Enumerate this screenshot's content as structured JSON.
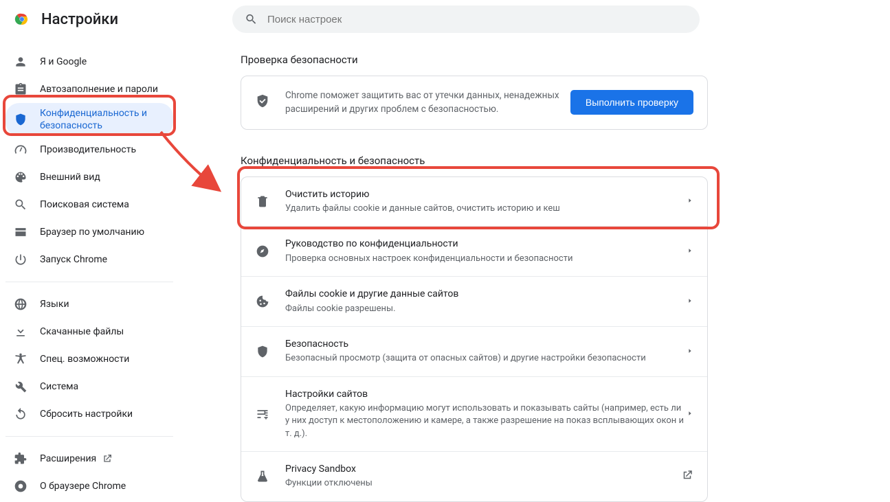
{
  "header": {
    "title": "Настройки",
    "search_placeholder": "Поиск настроек"
  },
  "sidebar": {
    "items": [
      {
        "label": "Я и Google",
        "icon": "person"
      },
      {
        "label": "Автозаполнение и пароли",
        "icon": "assignment"
      },
      {
        "label": "Конфиденциальность и безопасность",
        "icon": "shield",
        "selected": true
      },
      {
        "label": "Производительность",
        "icon": "speed"
      },
      {
        "label": "Внешний вид",
        "icon": "palette"
      },
      {
        "label": "Поисковая система",
        "icon": "search"
      },
      {
        "label": "Браузер по умолчанию",
        "icon": "browser"
      },
      {
        "label": "Запуск Chrome",
        "icon": "power"
      }
    ],
    "items2": [
      {
        "label": "Языки",
        "icon": "globe"
      },
      {
        "label": "Скачанные файлы",
        "icon": "download"
      },
      {
        "label": "Спец. возможности",
        "icon": "accessibility"
      },
      {
        "label": "Система",
        "icon": "wrench"
      },
      {
        "label": "Сбросить настройки",
        "icon": "reset"
      }
    ],
    "items3": [
      {
        "label": "Расширения",
        "icon": "extension",
        "external": true
      },
      {
        "label": "О браузере Chrome",
        "icon": "chrome"
      }
    ]
  },
  "safety": {
    "section_label": "Проверка безопасности",
    "text": "Chrome поможет защитить вас от утечки данных, ненадежных расширений и других проблем с безопасностью.",
    "button_label": "Выполнить проверку"
  },
  "privacy": {
    "section_label": "Конфиденциальность и безопасность",
    "rows": [
      {
        "icon": "trash",
        "title": "Очистить историю",
        "desc": "Удалить файлы cookie и данные сайтов, очистить историю и кеш"
      },
      {
        "icon": "compass",
        "title": "Руководство по конфиденциальности",
        "desc": "Проверка основных настроек конфиденциальности и безопасности"
      },
      {
        "icon": "cookie",
        "title": "Файлы cookie и другие данные сайтов",
        "desc": "Файлы cookie разрешены."
      },
      {
        "icon": "shield",
        "title": "Безопасность",
        "desc": "Безопасный просмотр (защита от опасных сайтов) и другие настройки безопасности"
      },
      {
        "icon": "tune",
        "title": "Настройки сайтов",
        "desc": "Определяет, какую информацию могут использовать и показывать сайты (например, есть ли у них доступ к местоположению и камере, а также разрешение на показ всплывающих окон и т. д.)."
      },
      {
        "icon": "flask",
        "title": "Privacy Sandbox",
        "desc": "Функции отключены",
        "external": true
      }
    ]
  }
}
